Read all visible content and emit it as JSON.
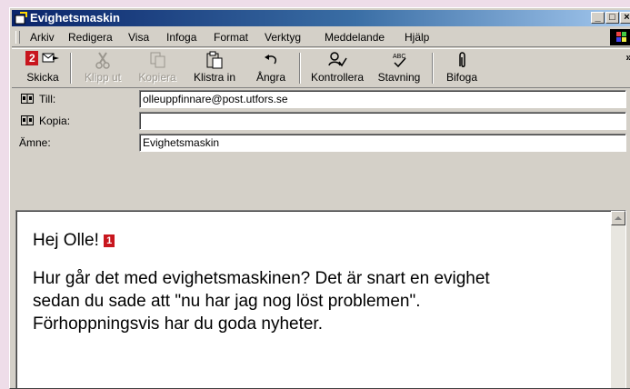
{
  "window": {
    "title": "Evighetsmaskin"
  },
  "titlebar_buttons": {
    "minimize": "_",
    "maximize": "□",
    "close": "×"
  },
  "menu": {
    "items": [
      {
        "label": "Arkiv"
      },
      {
        "label": "Redigera"
      },
      {
        "label": "Visa"
      },
      {
        "label": "Infoga"
      },
      {
        "label": "Format"
      },
      {
        "label": "Verktyg"
      },
      {
        "label": "Meddelande"
      },
      {
        "label": "Hjälp"
      }
    ]
  },
  "toolbar": {
    "send_badge": "2",
    "send": "Skicka",
    "cut": "Klipp ut",
    "copy": "Kopiera",
    "paste": "Klistra in",
    "undo": "Ångra",
    "check": "Kontrollera",
    "spelling": "Stavning",
    "attach": "Bifoga",
    "overflow": "»"
  },
  "fields": {
    "to_label": "Till:",
    "to_value": "olleuppfinnare@post.utfors.se",
    "cc_label": "Kopia:",
    "cc_value": "",
    "subject_label": "Ämne:",
    "subject_value": "Evighetsmaskin"
  },
  "message": {
    "greeting": "Hej Olle!",
    "greeting_badge": "1",
    "line1": "Hur går det med evighetsmaskinen? Det är snart en evighet",
    "line2": "sedan du sade att \"nu har jag nog löst problemen\".",
    "line3": "Förhoppningsvis har du goda nyheter."
  },
  "colors": {
    "badge": "#c8161e",
    "titlebar": "#0a246a",
    "background": "#eedde9"
  }
}
